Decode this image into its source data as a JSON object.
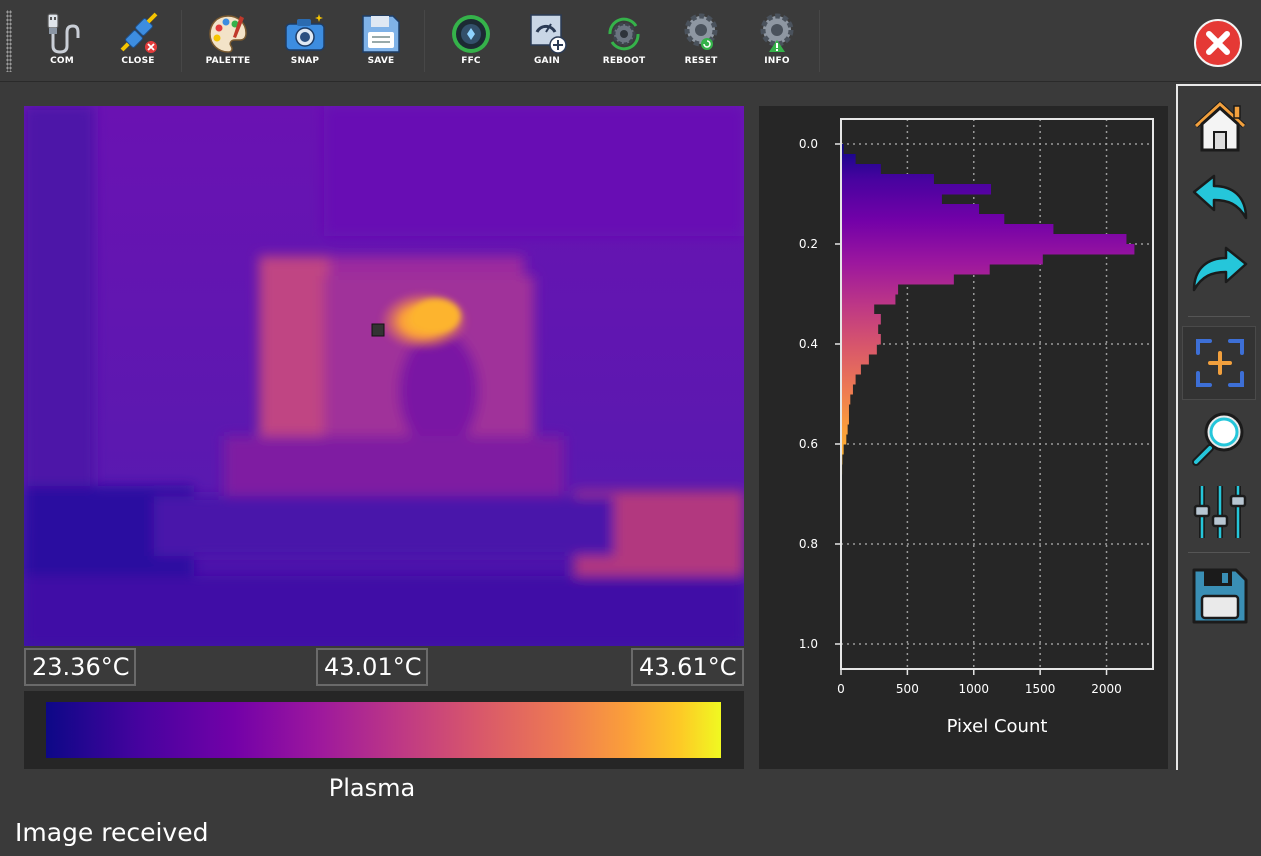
{
  "toolbar": {
    "buttons": [
      {
        "label": "COM",
        "icon": "usb-cable-icon"
      },
      {
        "label": "CLOSE",
        "icon": "unplug-icon"
      },
      {
        "label": "PALETTE",
        "icon": "palette-icon"
      },
      {
        "label": "SNAP",
        "icon": "camera-icon"
      },
      {
        "label": "SAVE",
        "icon": "floppy-icon"
      },
      {
        "label": "FFC",
        "icon": "shutter-icon"
      },
      {
        "label": "GAIN",
        "icon": "gain-icon"
      },
      {
        "label": "REBOOT",
        "icon": "reboot-icon"
      },
      {
        "label": "RESET",
        "icon": "reset-gear-icon"
      },
      {
        "label": "INFO",
        "icon": "info-gear-icon"
      }
    ],
    "close_icon": "close-icon"
  },
  "temps": {
    "min": "23.36°C",
    "center": "43.01°C",
    "max": "43.61°C"
  },
  "colormap": {
    "name": "Plasma"
  },
  "side_tools": [
    "home-icon",
    "back-arrow-icon",
    "forward-arrow-icon",
    "zoom-rect-icon",
    "magnifier-icon",
    "sliders-icon",
    "save-disk-icon"
  ],
  "status": "Image received",
  "chart_data": {
    "type": "bar",
    "orientation": "horizontal",
    "xlabel": "Pixel Count",
    "ylabel": "",
    "xlim": [
      0,
      2350
    ],
    "ylim": [
      1.05,
      -0.05
    ],
    "x_ticks": [
      "0",
      "500",
      "1000",
      "1500",
      "2000"
    ],
    "y_ticks": [
      "0.0",
      "0.2",
      "0.4",
      "0.6",
      "0.8",
      "1.0"
    ],
    "grid": true,
    "bins": [
      0.0,
      0.02,
      0.04,
      0.06,
      0.08,
      0.1,
      0.12,
      0.14,
      0.16,
      0.18,
      0.2,
      0.22,
      0.24,
      0.26,
      0.28,
      0.3,
      0.32,
      0.34,
      0.36,
      0.38,
      0.4,
      0.42,
      0.44,
      0.46,
      0.48,
      0.5,
      0.52,
      0.54,
      0.56,
      0.58,
      0.6,
      0.62,
      0.64,
      0.66,
      0.68
    ],
    "bin_width": 0.02,
    "counts": [
      20,
      110,
      300,
      700,
      1130,
      760,
      1040,
      1230,
      1600,
      2150,
      2210,
      1520,
      1120,
      850,
      430,
      410,
      250,
      300,
      280,
      300,
      270,
      210,
      150,
      110,
      90,
      70,
      60,
      60,
      50,
      40,
      20,
      10,
      8,
      5,
      2
    ]
  }
}
